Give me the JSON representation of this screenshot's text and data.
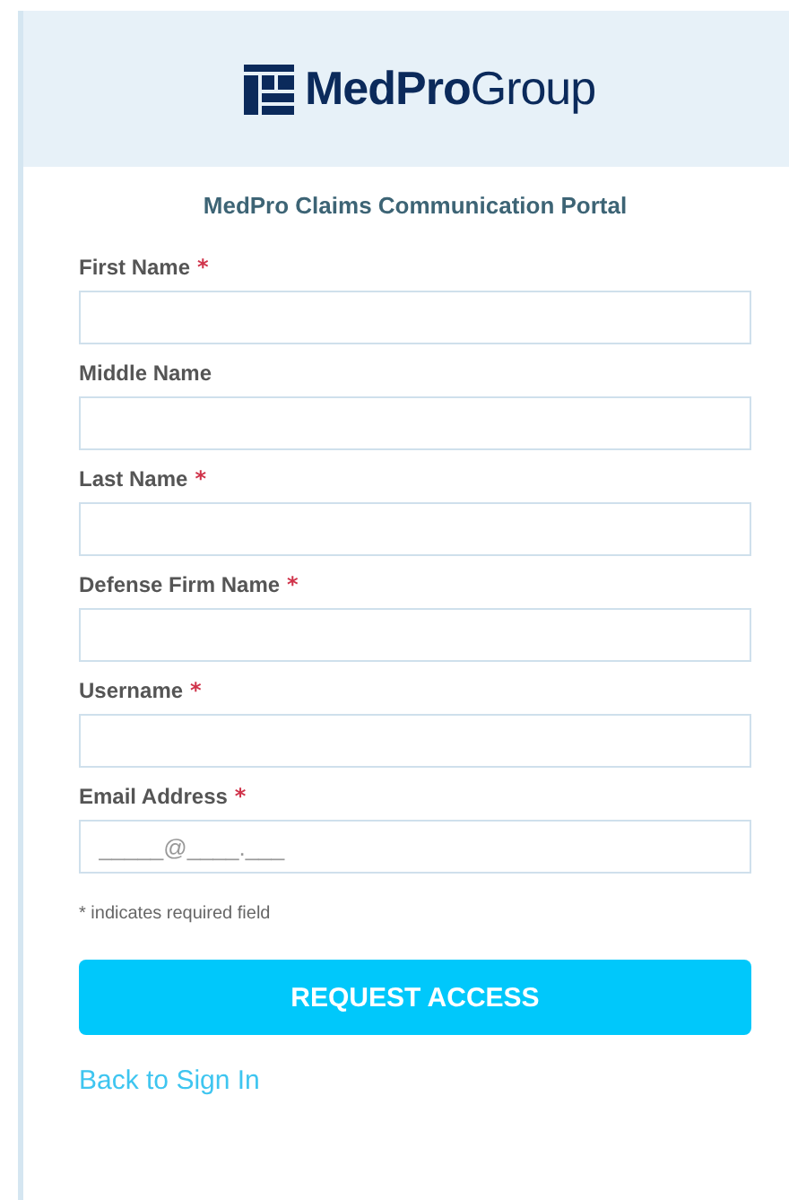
{
  "header": {
    "logo": {
      "bold": "MedPro",
      "light": "Group"
    }
  },
  "portal_title": "MedPro Claims Communication Portal",
  "fields": [
    {
      "label": "First Name",
      "required_mark": "*"
    },
    {
      "label": "Middle Name"
    },
    {
      "label": "Last Name",
      "required_mark": "*"
    },
    {
      "label": "Defense Firm Name",
      "required_mark": "*"
    },
    {
      "label": "Username",
      "required_mark": "*"
    },
    {
      "label": "Email Address",
      "required_mark": "*",
      "placeholder": "_____@____.___"
    }
  ],
  "required_note": "* indicates required field",
  "submit_button": "REQUEST ACCESS",
  "back_link": "Back to Sign In"
}
